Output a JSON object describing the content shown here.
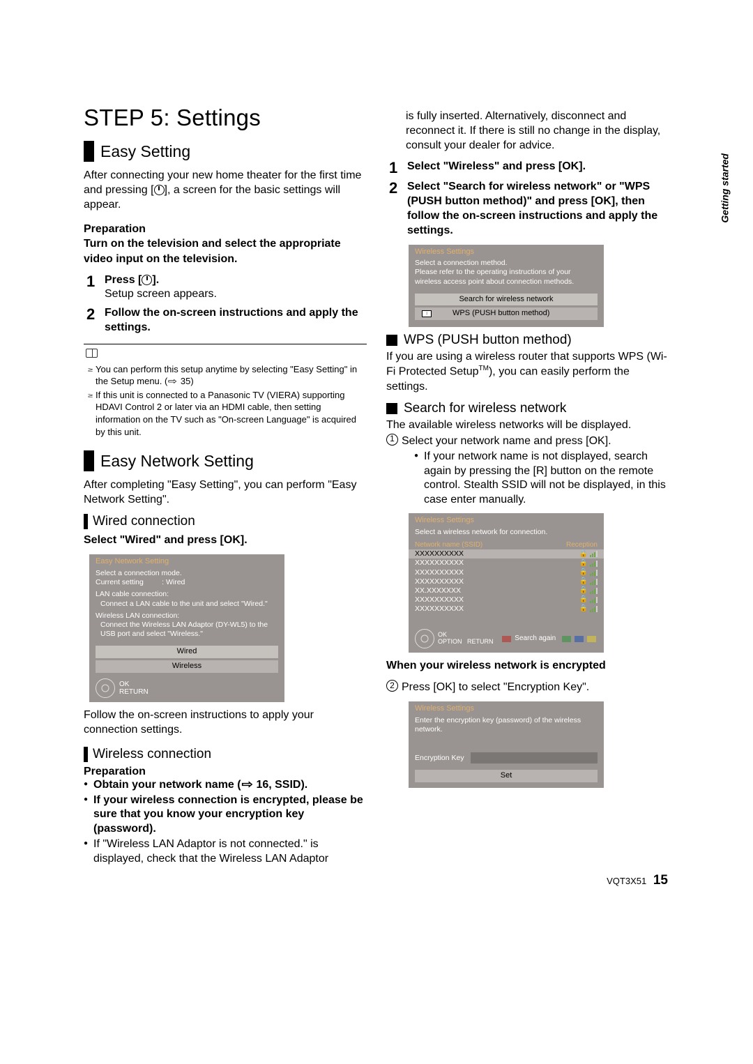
{
  "side_label": "Getting started",
  "footer": {
    "code": "VQT3X51",
    "page": "15"
  },
  "title": "STEP 5: Settings",
  "easy_setting": {
    "heading": "Easy Setting",
    "intro": "After connecting your new home theater for the first time and pressing [⏻], a screen for the basic settings will appear.",
    "prep_label": "Preparation",
    "prep_text": "Turn on the television and select the appropriate video input on the television.",
    "steps": [
      {
        "num": "1",
        "bold": "Press [⏻].",
        "body": "Setup screen appears."
      },
      {
        "num": "2",
        "bold": "Follow the on-screen instructions and apply the settings.",
        "body": ""
      }
    ],
    "notes": [
      "You can perform this setup anytime by selecting \"Easy Setting\" in the Setup menu. (⇨ 35)",
      "If this unit is connected to a Panasonic TV (VIERA) supporting HDAVI Control 2 or later via an HDMI cable, then setting information on the TV such as \"On-screen Language\" is acquired by this unit."
    ]
  },
  "easy_network": {
    "heading": "Easy Network Setting",
    "intro": "After completing \"Easy Setting\", you can perform \"Easy Network Setting\".",
    "wired": {
      "heading": "Wired connection",
      "instr": "Select \"Wired\" and press [OK].",
      "follow": "Follow the on-screen instructions to apply your connection settings.",
      "ui": {
        "title": "Easy Network Setting",
        "l1": "Select a connection mode.",
        "l2a": "Current setting",
        "l2b": ":  Wired",
        "l3": "LAN cable connection:",
        "l4": "Connect a LAN cable to the unit and select \"Wired.\"",
        "l5": "Wireless LAN connection:",
        "l6": "Connect the Wireless LAN Adaptor (DY-WL5) to the USB port and select \"Wireless.\"",
        "btn1": "Wired",
        "btn2": "Wireless",
        "ok": "OK",
        "return": "RETURN"
      }
    },
    "wireless": {
      "heading": "Wireless connection",
      "prep_label": "Preparation",
      "b1": "Obtain your network name (⇨ 16, SSID).",
      "b2": "If your wireless connection is encrypted, please be sure that you know your encryption key (password).",
      "b3": "If \"Wireless LAN Adaptor is not connected.\" is displayed, check that the Wireless LAN Adaptor"
    }
  },
  "col2": {
    "cont": "is fully inserted. Alternatively, disconnect and reconnect it. If there is still no change in the display, consult your dealer for advice.",
    "steps": [
      {
        "num": "1",
        "bold": "Select \"Wireless\" and press [OK]."
      },
      {
        "num": "2",
        "bold": "Select \"Search for wireless network\" or \"WPS (PUSH button method)\" and press [OK], then follow the on-screen instructions and apply the settings."
      }
    ],
    "ui1": {
      "title": "Wireless Settings",
      "l1": "Select a connection method.",
      "l2": "Please refer to the operating instructions of your wireless access point about connection methods.",
      "btn1": "Search for wireless network",
      "btn2": "WPS (PUSH button method)"
    },
    "wps": {
      "heading": "WPS (PUSH button method)",
      "text": "If you are using a wireless router that supports WPS (Wi-Fi Protected Setup™), you can easily perform the settings."
    },
    "search": {
      "heading": "Search for wireless network",
      "l1": "The available wireless networks will be displayed.",
      "s1": "Select your network name and press [OK].",
      "b1": "If your network name is not displayed, search again by pressing the [R] button on the remote control. Stealth SSID will not be displayed, in this case enter manually.",
      "ui": {
        "title": "Wireless Settings",
        "l1": "Select a wireless network for connection.",
        "hdr1": "Network name (SSID)",
        "hdr2": "Reception",
        "row": "XXXXXXXXXX",
        "ok": "OK",
        "option": "OPTION",
        "return": "RETURN",
        "search_again": "Search again"
      },
      "enc_head": "When your wireless network is encrypted",
      "s2": "Press [OK] to select \"Encryption Key\".",
      "ui2": {
        "title": "Wireless Settings",
        "l1": "Enter the encryption key (password) of the wireless network.",
        "lbl": "Encryption Key",
        "btn": "Set"
      }
    }
  }
}
